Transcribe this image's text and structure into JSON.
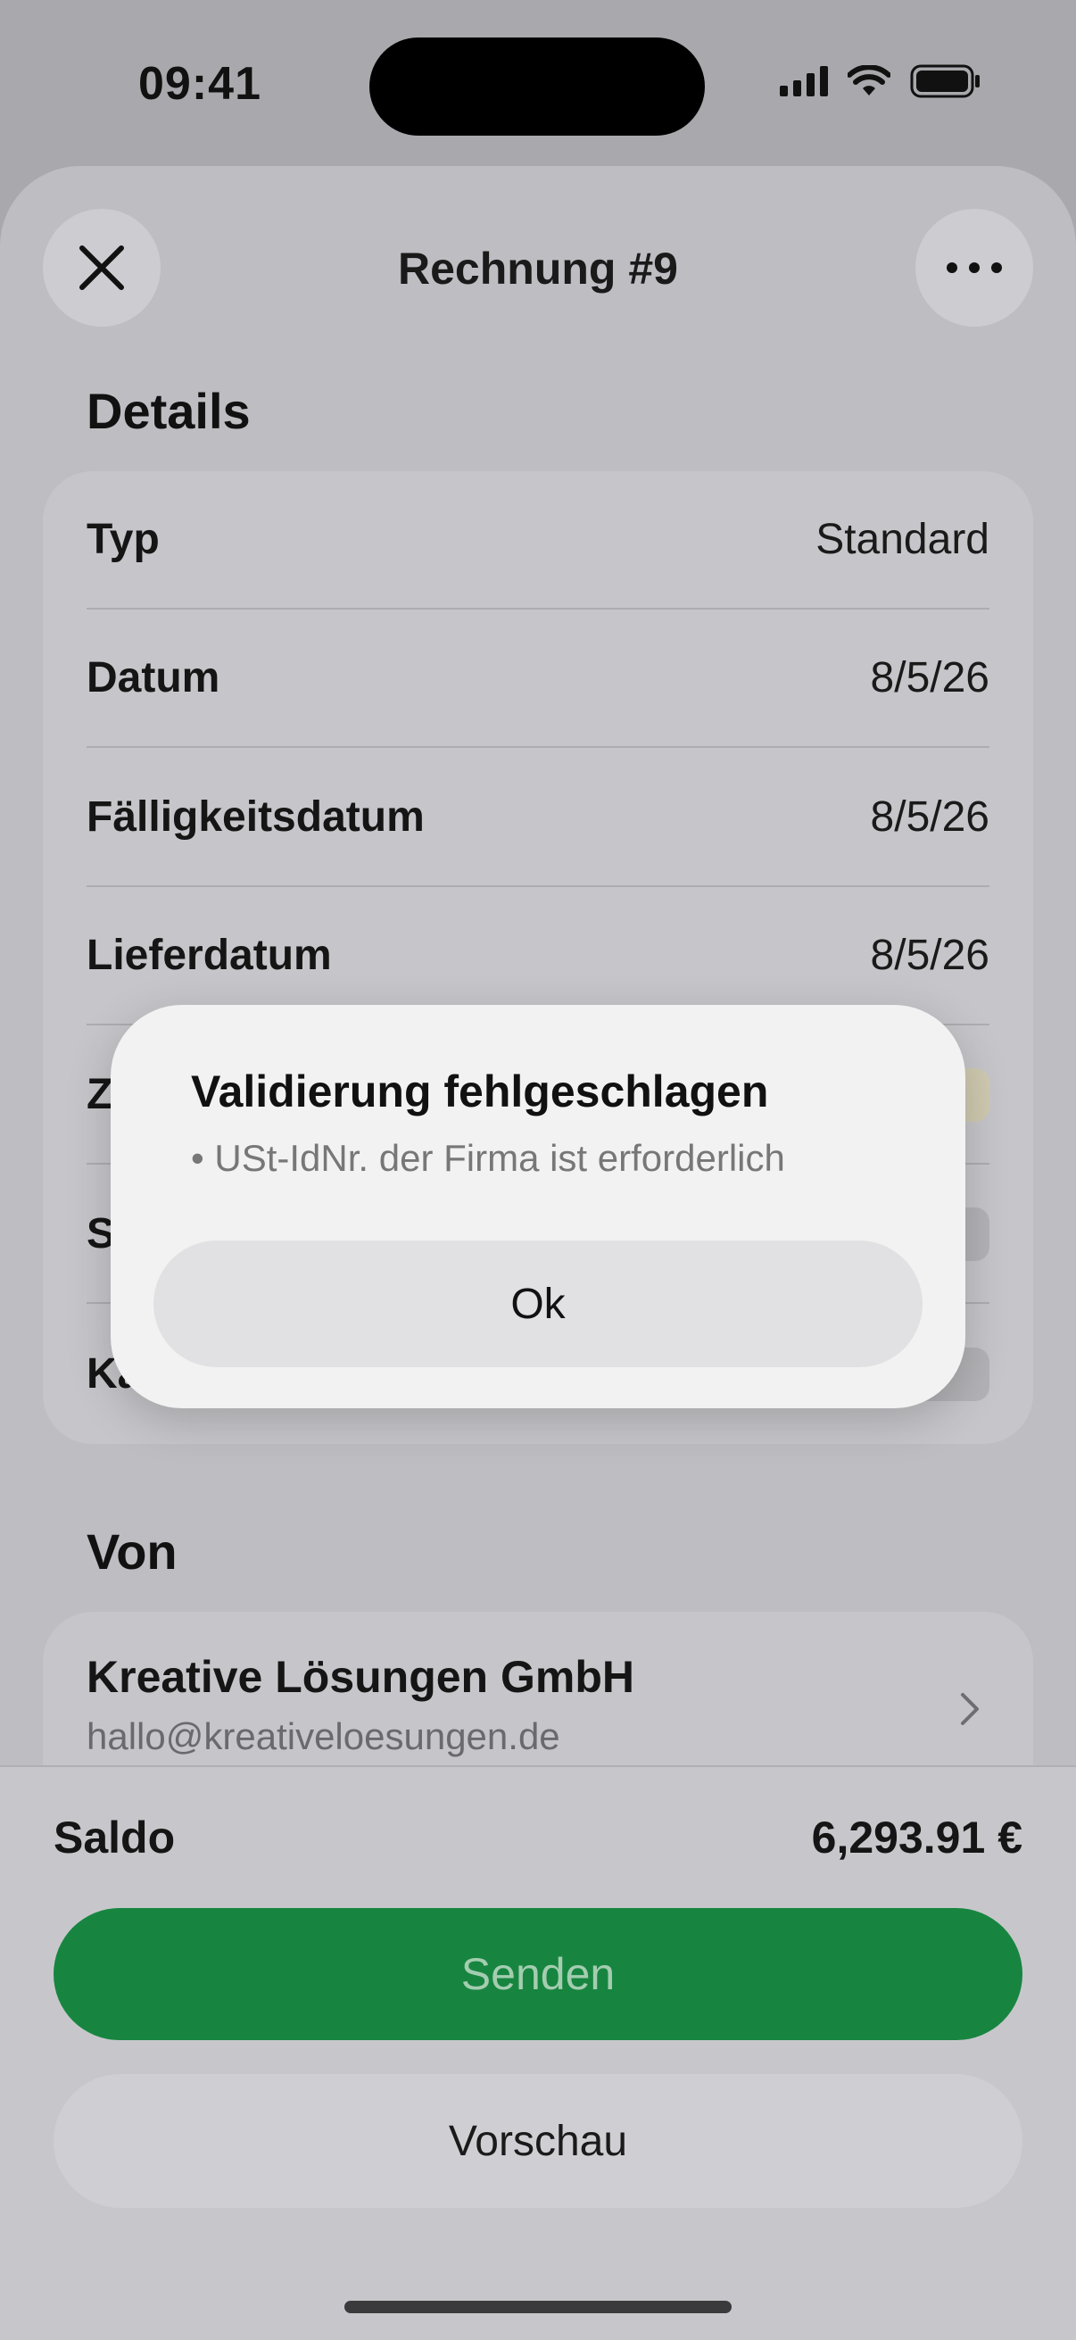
{
  "status_bar": {
    "time": "09:41"
  },
  "sheet": {
    "title": "Rechnung #9",
    "close_icon": "close-icon",
    "more_icon": "ellipsis-icon"
  },
  "details": {
    "section_title": "Details",
    "rows": [
      {
        "label": "Typ",
        "value": "Standard"
      },
      {
        "label": "Datum",
        "value": "8/5/26"
      },
      {
        "label": "Fälligkeitsdatum",
        "value": "8/5/26"
      },
      {
        "label": "Lieferdatum",
        "value": "8/5/26"
      },
      {
        "label": "Z",
        "value": ""
      },
      {
        "label": "S",
        "value": ""
      },
      {
        "label": "Ka",
        "value": ""
      }
    ]
  },
  "from": {
    "section_title": "Von",
    "company": "Kreative Lösungen GmbH",
    "email": "hallo@kreativeloesungen.de"
  },
  "bottom": {
    "balance_label": "Saldo",
    "balance_value": "6,293.91 €",
    "send_label": "Senden",
    "preview_label": "Vorschau"
  },
  "alert": {
    "title": "Validierung fehlgeschlagen",
    "message": "• USt-IdNr. der Firma ist erforderlich",
    "ok_label": "Ok"
  },
  "colors": {
    "send_button": "#178540",
    "dim_background": "#bdbdc2"
  }
}
